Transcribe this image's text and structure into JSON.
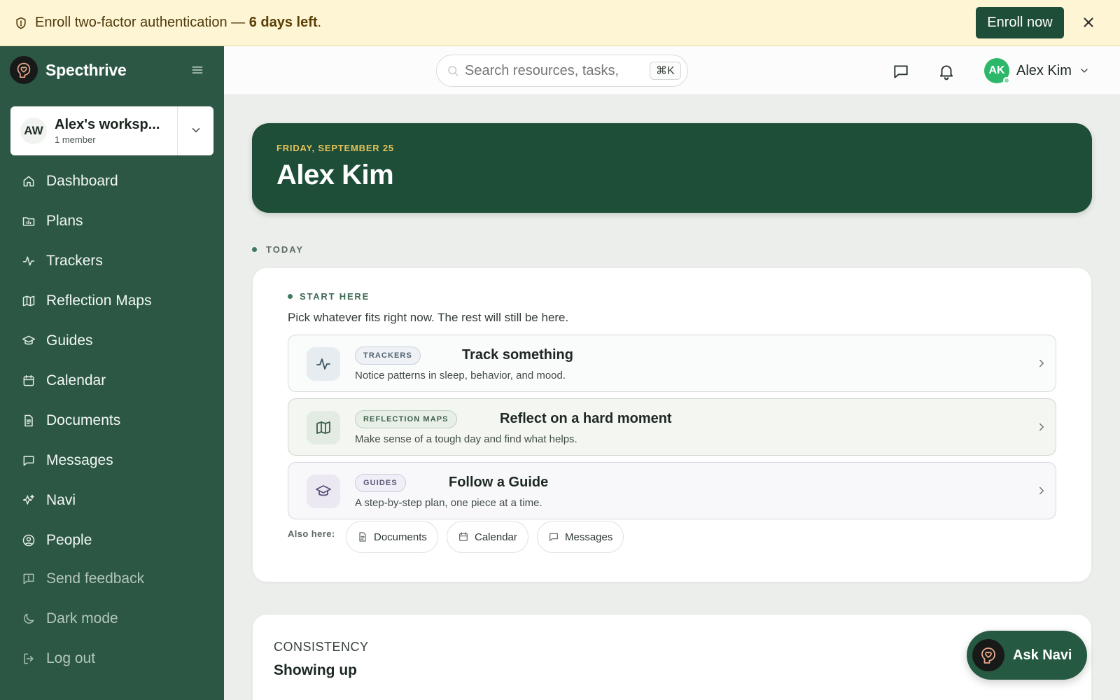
{
  "banner": {
    "message_prefix": "Enroll two-factor authentication — ",
    "message_bold": "6 days left",
    "message_suffix": ".",
    "enroll_label": "Enroll now"
  },
  "brand": {
    "name": "Specthrive"
  },
  "workspace": {
    "initials": "AW",
    "name": "Alex's worksp...",
    "members": "1 member"
  },
  "sidebar": {
    "items": [
      {
        "label": "Dashboard",
        "icon": "home-icon"
      },
      {
        "label": "Plans",
        "icon": "folder-chart-icon"
      },
      {
        "label": "Trackers",
        "icon": "activity-icon"
      },
      {
        "label": "Reflection Maps",
        "icon": "map-icon"
      },
      {
        "label": "Guides",
        "icon": "graduation-cap-icon"
      },
      {
        "label": "Calendar",
        "icon": "calendar-icon"
      },
      {
        "label": "Documents",
        "icon": "document-icon"
      },
      {
        "label": "Messages",
        "icon": "message-icon"
      },
      {
        "label": "Navi",
        "icon": "sparkles-icon"
      },
      {
        "label": "People",
        "icon": "user-circle-icon"
      }
    ],
    "secondary": [
      {
        "label": "Send feedback",
        "icon": "feedback-icon"
      },
      {
        "label": "Dark mode",
        "icon": "moon-icon"
      },
      {
        "label": "Log out",
        "icon": "logout-icon"
      }
    ]
  },
  "topbar": {
    "search_placeholder": "Search resources, tasks,",
    "shortcut": "⌘K",
    "user_initials": "AK",
    "user_name": "Alex Kim"
  },
  "hero": {
    "date": "FRIDAY, SEPTEMBER 25",
    "name": "Alex Kim"
  },
  "today": {
    "label": "TODAY"
  },
  "start": {
    "label": "START HERE",
    "subtitle": "Pick whatever fits right now. The rest will still be here.",
    "actions": [
      {
        "tag": "TRACKERS",
        "title": "Track something",
        "desc": "Notice patterns in sleep, behavior, and mood."
      },
      {
        "tag": "REFLECTION MAPS",
        "title": "Reflect on a hard moment",
        "desc": "Make sense of a tough day and find what helps."
      },
      {
        "tag": "GUIDES",
        "title": "Follow a Guide",
        "desc": "A step-by-step plan, one piece at a time."
      }
    ],
    "also_label": "Also here:",
    "also_links": [
      "Documents",
      "Calendar",
      "Messages"
    ]
  },
  "consistency": {
    "eyebrow": "CONSISTENCY",
    "title": "Showing up"
  },
  "ask": {
    "label": "Ask Navi"
  },
  "colors": {
    "brand_green": "#1e4d38",
    "sidebar_green": "#2b5744",
    "banner_bg": "#fdf5d3",
    "accent_gold": "#e4c35a"
  }
}
